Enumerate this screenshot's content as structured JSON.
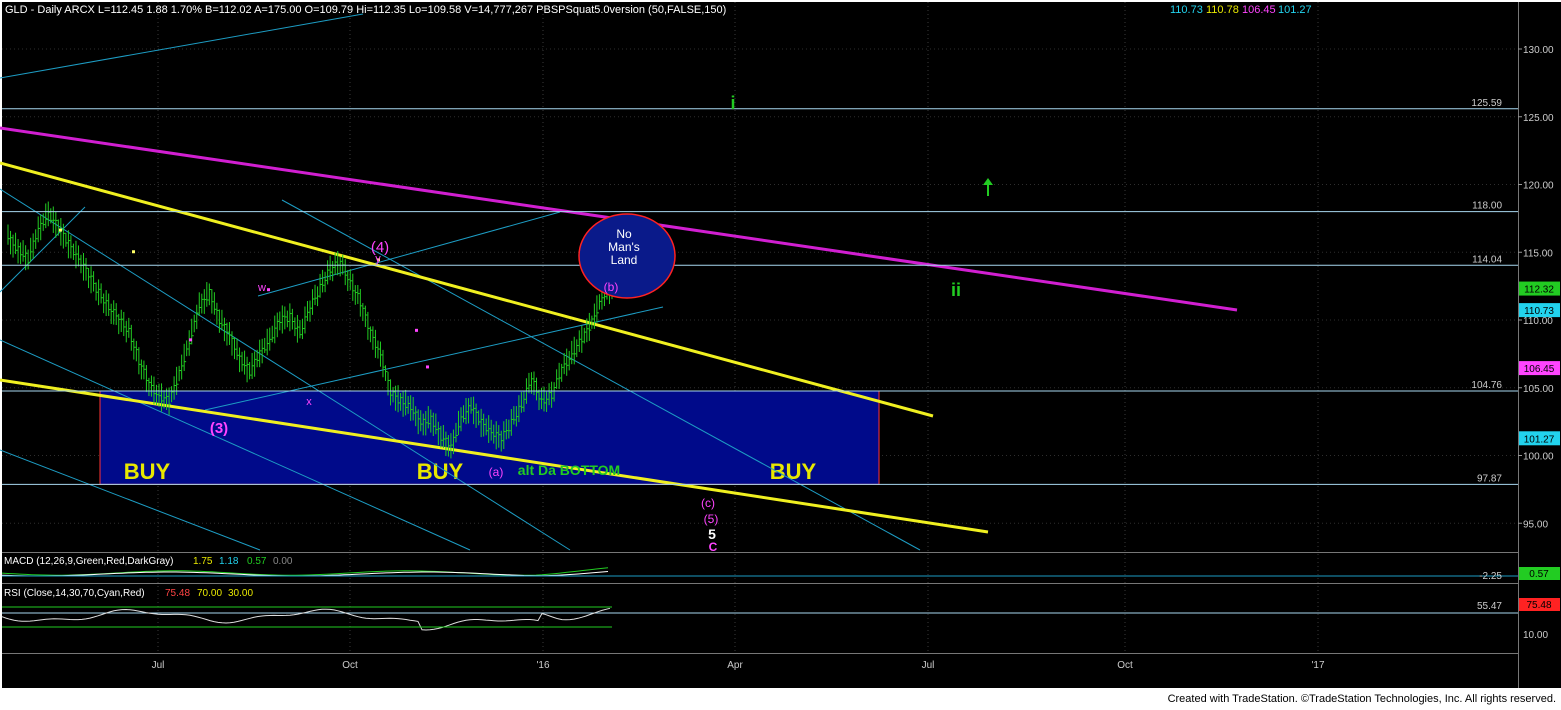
{
  "header": {
    "title": "GLD - Daily  ARCX  L=112.45  1.88  1.70%  B=112.02  A=175.00  O=109.79  Hi=112.35  Lo=109.58  V=14,777,267  PBSPSquat5.0version (50,FALSE,150)",
    "readings": [
      "110.73",
      "110.78",
      "106.45",
      "101.27"
    ],
    "reading_colors": [
      "#22d3ee",
      "#e8e800",
      "#ff44ff",
      "#22d3ee"
    ]
  },
  "footer": {
    "credit": "Created with TradeStation. ©TradeStation Technologies, Inc. All rights reserved."
  },
  "colors": {
    "background": "#000000",
    "bars": "#22cc22",
    "down_marks": "#ff44ff",
    "up_marks": "#ffff66",
    "trendline_yellow": "#f0f020",
    "trendline_magenta": "#d11fd1",
    "channel_cyan": "#1d9dc4",
    "level_line": "#a8d8f0",
    "buy_box": "#000a8a",
    "buy_text": "#e8e800",
    "circle_fill": "#0a1a8a",
    "circle_stroke": "#ff2222"
  },
  "chart_data": {
    "type": "line",
    "symbol": "GLD",
    "price_axis": {
      "ylim": [
        94.0,
        132.0
      ],
      "ticks": [
        "130.00",
        "125.00",
        "120.00",
        "115.00",
        "110.00",
        "105.00",
        "100.00",
        "95.00"
      ]
    },
    "x_axis": {
      "ticks": [
        "Jul",
        "Oct",
        "'16",
        "Apr",
        "Jul",
        "Oct",
        "'17"
      ]
    },
    "price_series": {
      "name": "GLD Daily",
      "close": [
        116.0,
        115.2,
        114.5,
        116.6,
        117.9,
        116.8,
        115.6,
        114.6,
        113.3,
        112.0,
        111.0,
        110.0,
        109.2,
        107.0,
        105.2,
        104.4,
        104.0,
        106.0,
        108.4,
        111.0,
        112.0,
        110.0,
        108.8,
        107.2,
        106.2,
        107.5,
        108.6,
        110.0,
        110.2,
        109.1,
        110.9,
        112.4,
        113.8,
        114.2,
        112.8,
        111.3,
        109.0,
        107.5,
        104.6,
        104.0,
        103.6,
        102.3,
        102.7,
        101.4,
        100.6,
        102.8,
        103.6,
        102.4,
        101.8,
        101.2,
        102.4,
        103.8,
        105.6,
        104.0,
        104.5,
        106.3,
        107.5,
        108.6,
        109.8,
        111.8,
        112.3
      ]
    },
    "horizontal_levels": [
      125.59,
      118.0,
      114.04,
      104.76,
      97.87
    ],
    "current_prices": [
      {
        "value": 112.32,
        "color": "#22cc22"
      },
      {
        "value": 110.73,
        "color": "#22d3ee"
      },
      {
        "value": 106.45,
        "color": "#ff44ff"
      },
      {
        "value": 101.27,
        "color": "#22d3ee"
      }
    ],
    "buy_zone": {
      "from": 97.87,
      "to": 104.76,
      "labels": [
        "BUY",
        "BUY",
        "BUY"
      ]
    },
    "no_mans_land": {
      "text_lines": [
        "No",
        "Man's",
        "Land"
      ]
    },
    "wave_labels": [
      {
        "text": "(3)",
        "color": "#ff44ff"
      },
      {
        "text": "w",
        "color": "#ff44ff"
      },
      {
        "text": "x",
        "color": "#ff44ff"
      },
      {
        "text": "y",
        "color": "#ff44ff"
      },
      {
        "text": "(4)",
        "color": "#ff44ff"
      },
      {
        "text": "(a)",
        "color": "#ff44ff"
      },
      {
        "text": "alt Da BOTTOM",
        "color": "#22cc22"
      },
      {
        "text": "(b)",
        "color": "#ff44ff"
      },
      {
        "text": "(c)",
        "color": "#ff44ff"
      },
      {
        "text": "(5)",
        "color": "#ff44ff"
      },
      {
        "text": "5",
        "color": "#ffffff"
      },
      {
        "text": "C",
        "color": "#ff44ff"
      },
      {
        "text": "i",
        "color": "#22cc22"
      },
      {
        "text": "ii",
        "color": "#22cc22"
      }
    ],
    "macd": {
      "title": "MACD (12,26,9,Green,Red,DarkGray)",
      "values": [
        "1.75",
        "1.18",
        "0.57",
        "0.00"
      ],
      "value_colors": [
        "#e8e800",
        "#22d3ee",
        "#22cc22",
        "#888888"
      ],
      "axis_label": "-2.25",
      "badge": "0.57",
      "badge_color": "#22cc22"
    },
    "rsi": {
      "title": "RSI (Close,14,30,70,Cyan,Red)",
      "values": [
        "75.48",
        "70.00",
        "30.00"
      ],
      "value_colors": [
        "#ff4444",
        "#e8e800",
        "#e8e800"
      ],
      "axis_labels": [
        "55.47",
        "10.00"
      ],
      "badge": "75.48",
      "badge_color": "#ff2222"
    }
  }
}
